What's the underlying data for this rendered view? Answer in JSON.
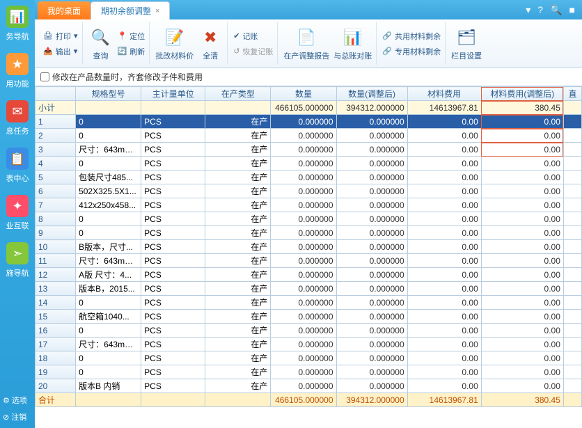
{
  "tabs": {
    "inactive": "我的桌面",
    "active": "期初余额调整"
  },
  "sysicons": {
    "help": "?",
    "search": "🔍",
    "win": "■"
  },
  "leftnav": {
    "items": [
      {
        "icon": "📊",
        "label": "务导航",
        "cls": "ic-green"
      },
      {
        "icon": "★",
        "label": "用功能",
        "cls": "ic-orange"
      },
      {
        "icon": "✉",
        "label": "息任务",
        "cls": "ic-red"
      },
      {
        "icon": "📋",
        "label": "表中心",
        "cls": "ic-blue"
      },
      {
        "icon": "✦",
        "label": "业互联",
        "cls": "ic-pink"
      },
      {
        "icon": "➣",
        "label": "施导航",
        "cls": "ic-lime"
      }
    ],
    "bottom": [
      {
        "icon": "⚙",
        "label": "选项"
      },
      {
        "icon": "⊘",
        "label": "注销"
      }
    ]
  },
  "ribbon": {
    "print": "打印",
    "export": "输出",
    "query": "查询",
    "refresh": "刷新",
    "locate": "定位",
    "batch": "批改材料价",
    "clear": "全清",
    "post": "记账",
    "undo": "恢复记账",
    "report": "在产调整报告",
    "gl": "与总账对账",
    "shared": "共用材料剩余",
    "special": "专用材料剩余",
    "colset": "栏目设置"
  },
  "checkbox_label": "修改在产品数量时，齐套修改子件和费用",
  "columns": [
    "",
    "规格型号",
    "主计量单位",
    "在产类型",
    "数量",
    "数量(调整后)",
    "材料费用",
    "材料费用(调整后)",
    "直"
  ],
  "subtotal": {
    "label": "小计",
    "qty": "466105.000000",
    "qty_adj": "394312.000000",
    "mat": "14613967.81",
    "mat_adj": "380.45"
  },
  "rows": [
    {
      "n": "1",
      "spec": "0",
      "uom": "PCS",
      "type": "在产",
      "qty": "0.000000",
      "qty_adj": "0.000000",
      "mat": "0.00",
      "mat_adj": "0.00",
      "sel": true
    },
    {
      "n": "2",
      "spec": "0",
      "uom": "PCS",
      "type": "在产",
      "qty": "0.000000",
      "qty_adj": "0.000000",
      "mat": "0.00",
      "mat_adj": "0.00"
    },
    {
      "n": "3",
      "spec": "尺寸：643mm...",
      "uom": "PCS",
      "type": "在产",
      "qty": "0.000000",
      "qty_adj": "0.000000",
      "mat": "0.00",
      "mat_adj": "0.00"
    },
    {
      "n": "4",
      "spec": "0",
      "uom": "PCS",
      "type": "在产",
      "qty": "0.000000",
      "qty_adj": "0.000000",
      "mat": "0.00",
      "mat_adj": "0.00"
    },
    {
      "n": "5",
      "spec": "包装尺寸485...",
      "uom": "PCS",
      "type": "在产",
      "qty": "0.000000",
      "qty_adj": "0.000000",
      "mat": "0.00",
      "mat_adj": "0.00"
    },
    {
      "n": "6",
      "spec": "502X325.5X1...",
      "uom": "PCS",
      "type": "在产",
      "qty": "0.000000",
      "qty_adj": "0.000000",
      "mat": "0.00",
      "mat_adj": "0.00"
    },
    {
      "n": "7",
      "spec": "412x250x458...",
      "uom": "PCS",
      "type": "在产",
      "qty": "0.000000",
      "qty_adj": "0.000000",
      "mat": "0.00",
      "mat_adj": "0.00"
    },
    {
      "n": "8",
      "spec": "0",
      "uom": "PCS",
      "type": "在产",
      "qty": "0.000000",
      "qty_adj": "0.000000",
      "mat": "0.00",
      "mat_adj": "0.00"
    },
    {
      "n": "9",
      "spec": "0",
      "uom": "PCS",
      "type": "在产",
      "qty": "0.000000",
      "qty_adj": "0.000000",
      "mat": "0.00",
      "mat_adj": "0.00"
    },
    {
      "n": "10",
      "spec": "B版本，尺寸...",
      "uom": "PCS",
      "type": "在产",
      "qty": "0.000000",
      "qty_adj": "0.000000",
      "mat": "0.00",
      "mat_adj": "0.00"
    },
    {
      "n": "11",
      "spec": "尺寸：643mm...",
      "uom": "PCS",
      "type": "在产",
      "qty": "0.000000",
      "qty_adj": "0.000000",
      "mat": "0.00",
      "mat_adj": "0.00"
    },
    {
      "n": "12",
      "spec": "A版 尺寸：4...",
      "uom": "PCS",
      "type": "在产",
      "qty": "0.000000",
      "qty_adj": "0.000000",
      "mat": "0.00",
      "mat_adj": "0.00"
    },
    {
      "n": "13",
      "spec": "版本B，2015...",
      "uom": "PCS",
      "type": "在产",
      "qty": "0.000000",
      "qty_adj": "0.000000",
      "mat": "0.00",
      "mat_adj": "0.00"
    },
    {
      "n": "14",
      "spec": "0",
      "uom": "PCS",
      "type": "在产",
      "qty": "0.000000",
      "qty_adj": "0.000000",
      "mat": "0.00",
      "mat_adj": "0.00"
    },
    {
      "n": "15",
      "spec": "航空箱1040...",
      "uom": "PCS",
      "type": "在产",
      "qty": "0.000000",
      "qty_adj": "0.000000",
      "mat": "0.00",
      "mat_adj": "0.00"
    },
    {
      "n": "16",
      "spec": "0",
      "uom": "PCS",
      "type": "在产",
      "qty": "0.000000",
      "qty_adj": "0.000000",
      "mat": "0.00",
      "mat_adj": "0.00"
    },
    {
      "n": "17",
      "spec": "尺寸：643mm...",
      "uom": "PCS",
      "type": "在产",
      "qty": "0.000000",
      "qty_adj": "0.000000",
      "mat": "0.00",
      "mat_adj": "0.00"
    },
    {
      "n": "18",
      "spec": "0",
      "uom": "PCS",
      "type": "在产",
      "qty": "0.000000",
      "qty_adj": "0.000000",
      "mat": "0.00",
      "mat_adj": "0.00"
    },
    {
      "n": "19",
      "spec": "0",
      "uom": "PCS",
      "type": "在产",
      "qty": "0.000000",
      "qty_adj": "0.000000",
      "mat": "0.00",
      "mat_adj": "0.00"
    },
    {
      "n": "20",
      "spec": "版本B 内销",
      "uom": "PCS",
      "type": "在产",
      "qty": "0.000000",
      "qty_adj": "0.000000",
      "mat": "0.00",
      "mat_adj": "0.00"
    }
  ],
  "total": {
    "label": "合计",
    "qty": "466105.000000",
    "qty_adj": "394312.000000",
    "mat": "14613967.81",
    "mat_adj": "380.45"
  }
}
